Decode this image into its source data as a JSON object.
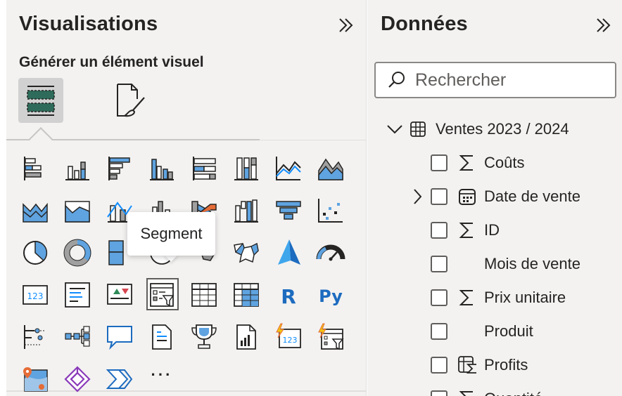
{
  "visualizations": {
    "title": "Visualisations",
    "subheading": "Générer un élément visuel",
    "collapse_icon": "chevron-double-right-icon",
    "tabs": [
      {
        "name": "build-visual",
        "icon": "build-visual-icon",
        "active": true
      },
      {
        "name": "format-visual",
        "icon": "format-visual-icon",
        "active": false
      }
    ],
    "tooltip": "Segment",
    "more_label": "···",
    "gallery_icons": [
      "stacked-bar-chart-icon",
      "stacked-column-chart-icon",
      "clustered-bar-chart-icon",
      "clustered-column-chart-icon",
      "100-stacked-bar-chart-icon",
      "100-stacked-column-chart-icon",
      "line-chart-icon",
      "area-chart-icon",
      "stacked-area-chart-icon",
      "100-stacked-area-chart-icon",
      "line-and-stacked-column-icon",
      "line-and-clustered-column-icon",
      "ribbon-chart-icon",
      "waterfall-chart-icon",
      "funnel-chart-icon",
      "scatter-chart-icon",
      "pie-chart-icon",
      "donut-chart-icon",
      "treemap-icon",
      "map-icon",
      "filled-map-icon",
      "shape-map-icon",
      "azure-map-icon",
      "gauge-icon",
      "card-icon",
      "multi-row-card-icon",
      "kpi-icon",
      "slicer-icon",
      "table-icon",
      "matrix-icon",
      "r-visual-icon",
      "python-visual-icon",
      "key-influencers-icon",
      "decomposition-tree-icon",
      "qa-icon",
      "smart-narrative-icon",
      "metrics-icon",
      "paginated-report-icon",
      "power-automate-card-icon",
      "power-automate-slicer-icon",
      "arcgis-map-icon",
      "power-apps-icon",
      "power-automate-icon",
      "more-visuals-icon"
    ]
  },
  "data_pane": {
    "title": "Données",
    "collapse_icon": "chevron-double-right-icon",
    "search": {
      "placeholder": "Rechercher",
      "icon": "search-icon"
    },
    "table": {
      "name": "Ventes 2023 / 2024",
      "icon": "table-icon",
      "expanded": true
    },
    "fields": [
      {
        "label": "Coûts",
        "icon": "sigma-icon",
        "expandable": false
      },
      {
        "label": "Date de vente",
        "icon": "calendar-icon",
        "expandable": true
      },
      {
        "label": "ID",
        "icon": "sigma-icon",
        "expandable": false
      },
      {
        "label": "Mois de vente",
        "icon": "",
        "expandable": false
      },
      {
        "label": "Prix unitaire",
        "icon": "sigma-icon",
        "expandable": false
      },
      {
        "label": "Produit",
        "icon": "",
        "expandable": false
      },
      {
        "label": "Profits",
        "icon": "calculated-column-icon",
        "expandable": false
      },
      {
        "label": "Quantité",
        "icon": "sigma-icon",
        "expandable": false
      }
    ]
  },
  "colors": {
    "pane_background": "#f3f2f1",
    "accent_blue": "#118dff",
    "accent_light_blue": "#5fa3e0",
    "text": "#252423",
    "tab_active": "#d1d1d1",
    "build_icon_green": "#2e6b5a",
    "orange": "#e66c37",
    "yellow": "#f2c811",
    "purple": "#8a3ab9",
    "red": "#d64550"
  }
}
